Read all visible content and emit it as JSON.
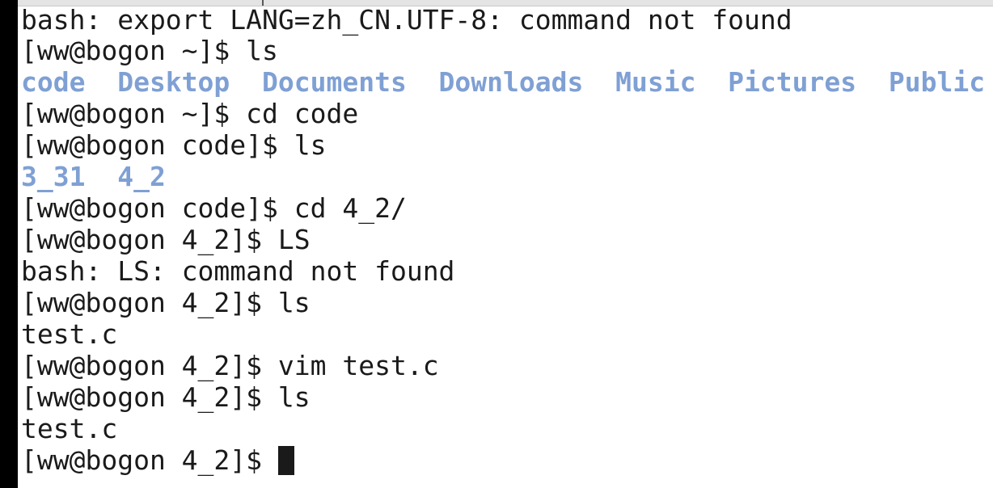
{
  "window": {
    "type": "terminal-emulator",
    "background_color": "#ffffff",
    "foreground_color": "#1a1a1a",
    "directory_color": "#7fa0d4",
    "chrome_strip_color": "#e4e4e4",
    "left_band_color": "#000000"
  },
  "terminal": {
    "host": "bogon",
    "user": "ww",
    "cursor": "block",
    "lines": [
      {
        "id": "line-lang-error",
        "kind": "output",
        "segments": [
          {
            "text": "bash: export LANG=zh_CN.UTF-8: command not found",
            "style": "plain"
          }
        ]
      },
      {
        "id": "line-prompt-ls-home",
        "kind": "prompt",
        "segments": [
          {
            "text": "[ww@bogon ~]$ ls",
            "style": "plain"
          }
        ]
      },
      {
        "id": "line-home-listing",
        "kind": "output",
        "segments": [
          {
            "text": "code  Desktop  Documents  Downloads  Music  Pictures  Public",
            "style": "dir"
          }
        ]
      },
      {
        "id": "line-prompt-cd-code",
        "kind": "prompt",
        "segments": [
          {
            "text": "[ww@bogon ~]$ cd code",
            "style": "plain"
          }
        ]
      },
      {
        "id": "line-prompt-ls-code",
        "kind": "prompt",
        "segments": [
          {
            "text": "[ww@bogon code]$ ls",
            "style": "plain"
          }
        ]
      },
      {
        "id": "line-code-listing",
        "kind": "output",
        "segments": [
          {
            "text": "3_31  4_2",
            "style": "dir"
          }
        ]
      },
      {
        "id": "line-prompt-cd-4-2",
        "kind": "prompt",
        "segments": [
          {
            "text": "[ww@bogon code]$ cd 4_2/",
            "style": "plain"
          }
        ]
      },
      {
        "id": "line-prompt-LS",
        "kind": "prompt",
        "segments": [
          {
            "text": "[ww@bogon 4_2]$ LS",
            "style": "plain"
          }
        ]
      },
      {
        "id": "line-LS-error",
        "kind": "output",
        "segments": [
          {
            "text": "bash: LS: command not found",
            "style": "plain"
          }
        ]
      },
      {
        "id": "line-prompt-ls-4-2",
        "kind": "prompt",
        "segments": [
          {
            "text": "[ww@bogon 4_2]$ ls",
            "style": "plain"
          }
        ]
      },
      {
        "id": "line-listing-testc-1",
        "kind": "output",
        "segments": [
          {
            "text": "test.c",
            "style": "plain"
          }
        ]
      },
      {
        "id": "line-prompt-vim",
        "kind": "prompt",
        "segments": [
          {
            "text": "[ww@bogon 4_2]$ vim test.c",
            "style": "plain"
          }
        ]
      },
      {
        "id": "line-prompt-ls-after-vim",
        "kind": "prompt",
        "segments": [
          {
            "text": "[ww@bogon 4_2]$ ls",
            "style": "plain"
          }
        ]
      },
      {
        "id": "line-listing-testc-2",
        "kind": "output",
        "segments": [
          {
            "text": "test.c",
            "style": "plain"
          }
        ]
      },
      {
        "id": "line-prompt-current",
        "kind": "prompt-active",
        "segments": [
          {
            "text": "[ww@bogon 4_2]$ ",
            "style": "plain"
          }
        ],
        "has_cursor": true
      }
    ]
  }
}
